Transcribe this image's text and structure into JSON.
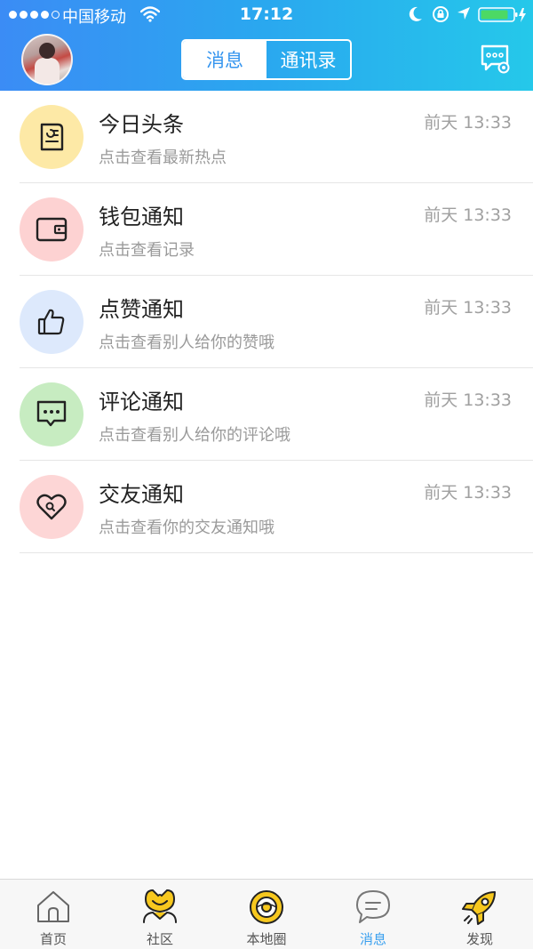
{
  "status_bar": {
    "carrier": "中国移动",
    "time": "17:12"
  },
  "header": {
    "tabs": [
      {
        "label": "消息",
        "active": true
      },
      {
        "label": "通讯录",
        "active": false
      }
    ]
  },
  "messages": [
    {
      "title": "今日头条",
      "subtitle": "点击查看最新热点",
      "time": "前天 13:33",
      "icon": "news-icon",
      "icon_bg": "#fde9a6"
    },
    {
      "title": "钱包通知",
      "subtitle": "点击查看记录",
      "time": "前天 13:33",
      "icon": "wallet-icon",
      "icon_bg": "#fdd2d2"
    },
    {
      "title": "点赞通知",
      "subtitle": "点击查看别人给你的赞哦",
      "time": "前天 13:33",
      "icon": "thumbs-up-icon",
      "icon_bg": "#dde9fc"
    },
    {
      "title": "评论通知",
      "subtitle": "点击查看别人给你的评论哦",
      "time": "前天 13:33",
      "icon": "comment-icon",
      "icon_bg": "#c7ecc1"
    },
    {
      "title": "交友通知",
      "subtitle": "点击查看你的交友通知哦",
      "time": "前天 13:33",
      "icon": "heart-icon",
      "icon_bg": "#fdd6d6"
    }
  ],
  "tabbar": {
    "items": [
      {
        "label": "首页",
        "icon": "home-icon",
        "active": false
      },
      {
        "label": "社区",
        "icon": "community-icon",
        "active": false
      },
      {
        "label": "本地圈",
        "icon": "local-circle-icon",
        "active": false
      },
      {
        "label": "消息",
        "icon": "message-icon",
        "active": true
      },
      {
        "label": "发现",
        "icon": "rocket-icon",
        "active": false
      }
    ]
  },
  "colors": {
    "header_gradient_start": "#3b8cf5",
    "header_gradient_end": "#25c8ea",
    "accent": "#3595ef",
    "tab_active": "#3aa0ef"
  }
}
